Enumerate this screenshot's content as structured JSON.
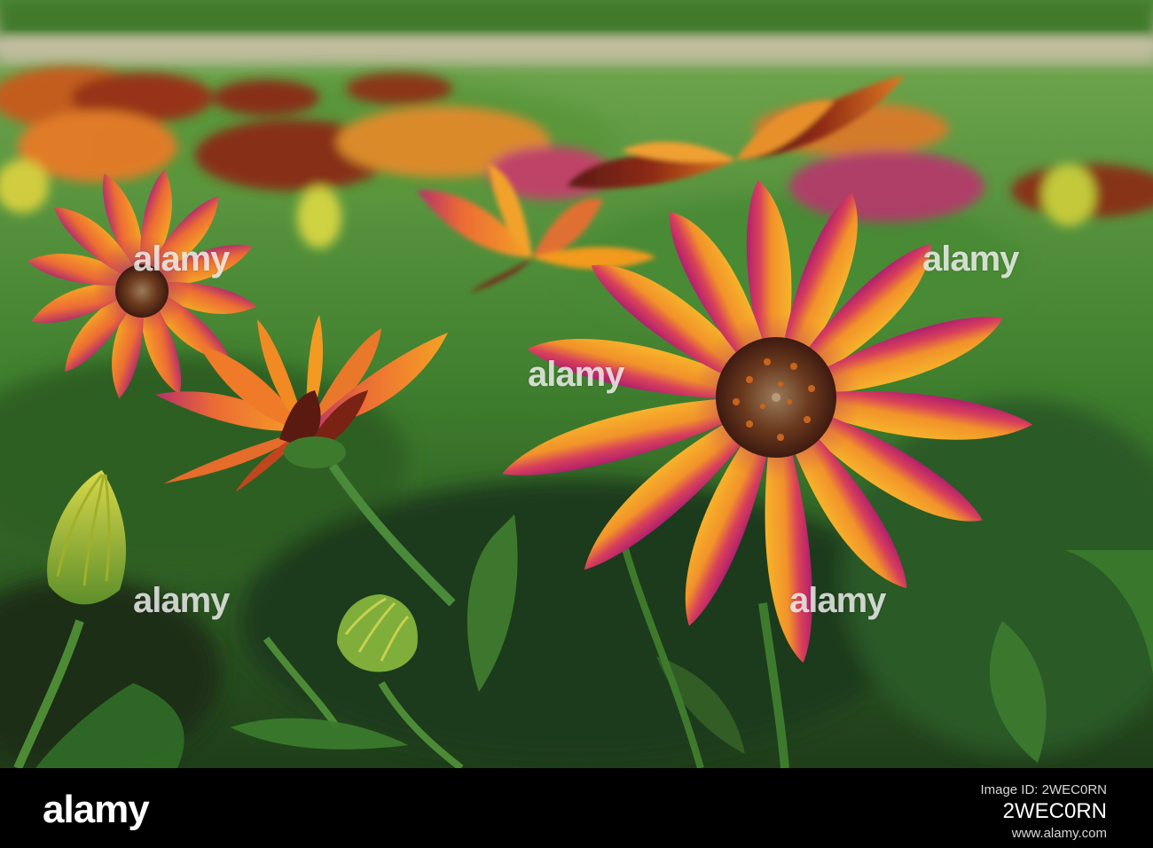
{
  "image": {
    "subject": "orange and magenta African daisies (Osteospermum) with buds and green foliage",
    "colors": {
      "petal_orange": "#f39a1c",
      "petal_magenta": "#c0206f",
      "center_brown": "#6b3a1e",
      "foliage_green": "#3f8a2e",
      "bud_yellow": "#c9cf3a",
      "footer_bg": "#000000"
    }
  },
  "watermark": {
    "text": "alamy"
  },
  "footer": {
    "logo": "alamy",
    "image_id_label": "Image ID: 2WEC0RN",
    "image_id": "2WEC0RN",
    "site": "www.alamy.com"
  }
}
